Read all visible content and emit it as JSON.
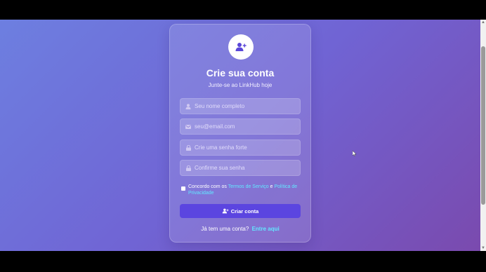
{
  "signup": {
    "title": "Crie sua conta",
    "subtitle": "Junte-se ao LinkHub hoje",
    "fields": {
      "name": {
        "placeholder": "Seu nome completo",
        "icon": "user-icon"
      },
      "email": {
        "placeholder": "seu@email.com",
        "icon": "envelope-icon"
      },
      "password": {
        "placeholder": "Crie uma senha forte",
        "icon": "lock-icon"
      },
      "confirm": {
        "placeholder": "Confirme sua senha",
        "icon": "lock-icon"
      }
    },
    "terms": {
      "prefix": "Concordo com os",
      "terms_link": "Termos de Serviço",
      "conjunction": "e",
      "privacy_link": "Política de Privacidade"
    },
    "submit_label": "Criar conta",
    "login_prompt": "Já tem uma conta?",
    "login_link": "Entre aqui"
  },
  "colors": {
    "bg_start": "#6d7fe0",
    "bg_end": "#7a4aae",
    "button": "#5b45e0",
    "link": "#62e6ff"
  }
}
